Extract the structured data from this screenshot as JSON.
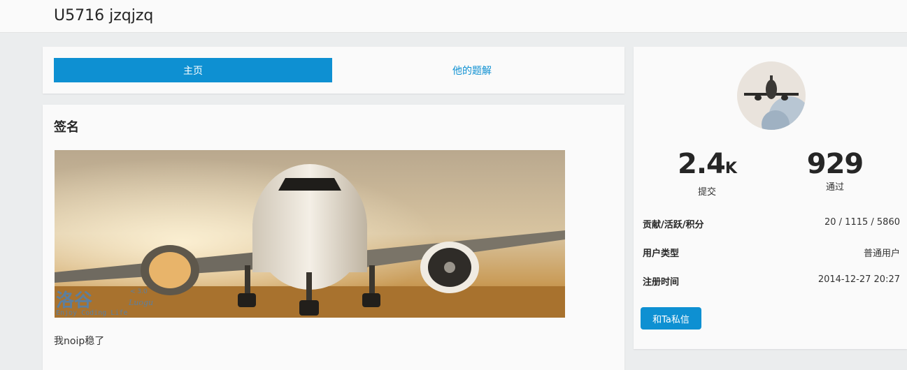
{
  "header": {
    "title": "U5716 jzqjzq"
  },
  "tabs": [
    {
      "label": "主页",
      "active": true
    },
    {
      "label": "他的题解",
      "active": false
    }
  ],
  "signature": {
    "heading": "签名",
    "image_logo": {
      "main": "洛谷",
      "version": "< 3.0",
      "latin": "Luogu",
      "slogan": "Enjoy Coding Life"
    },
    "text": "我noip稳了"
  },
  "profile": {
    "stats": {
      "submit": {
        "value": "2.4",
        "unit": "K",
        "label": "提交"
      },
      "pass": {
        "value": "929",
        "label": "通过"
      }
    },
    "info": [
      {
        "key": "贡献/活跃/积分",
        "value": "20 / 1115 / 5860"
      },
      {
        "key": "用户类型",
        "value": "普通用户"
      },
      {
        "key": "注册时间",
        "value": "2014-12-27 20:27"
      }
    ],
    "message_button": "和Ta私信"
  },
  "colors": {
    "accent": "#0e90d2",
    "background": "#ebedee",
    "card": "#fafafa"
  }
}
